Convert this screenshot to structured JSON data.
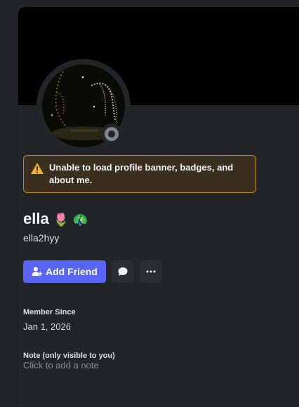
{
  "profile": {
    "display_name": "ella",
    "name_emojis": "🌷 🦚",
    "username": "ella2hyy",
    "status": "offline"
  },
  "warning": {
    "text": "Unable to load profile banner, badges, and about me."
  },
  "actions": {
    "add_friend_label": "Add Friend"
  },
  "member_since": {
    "title": "Member Since",
    "value": "Jan 1, 2026"
  },
  "note": {
    "title": "Note (only visible to you)",
    "placeholder": "Click to add a note"
  },
  "colors": {
    "accent": "#5865f2",
    "warning_border": "#c98a1a",
    "banner": "#000000",
    "status_offline": "#80848e"
  }
}
